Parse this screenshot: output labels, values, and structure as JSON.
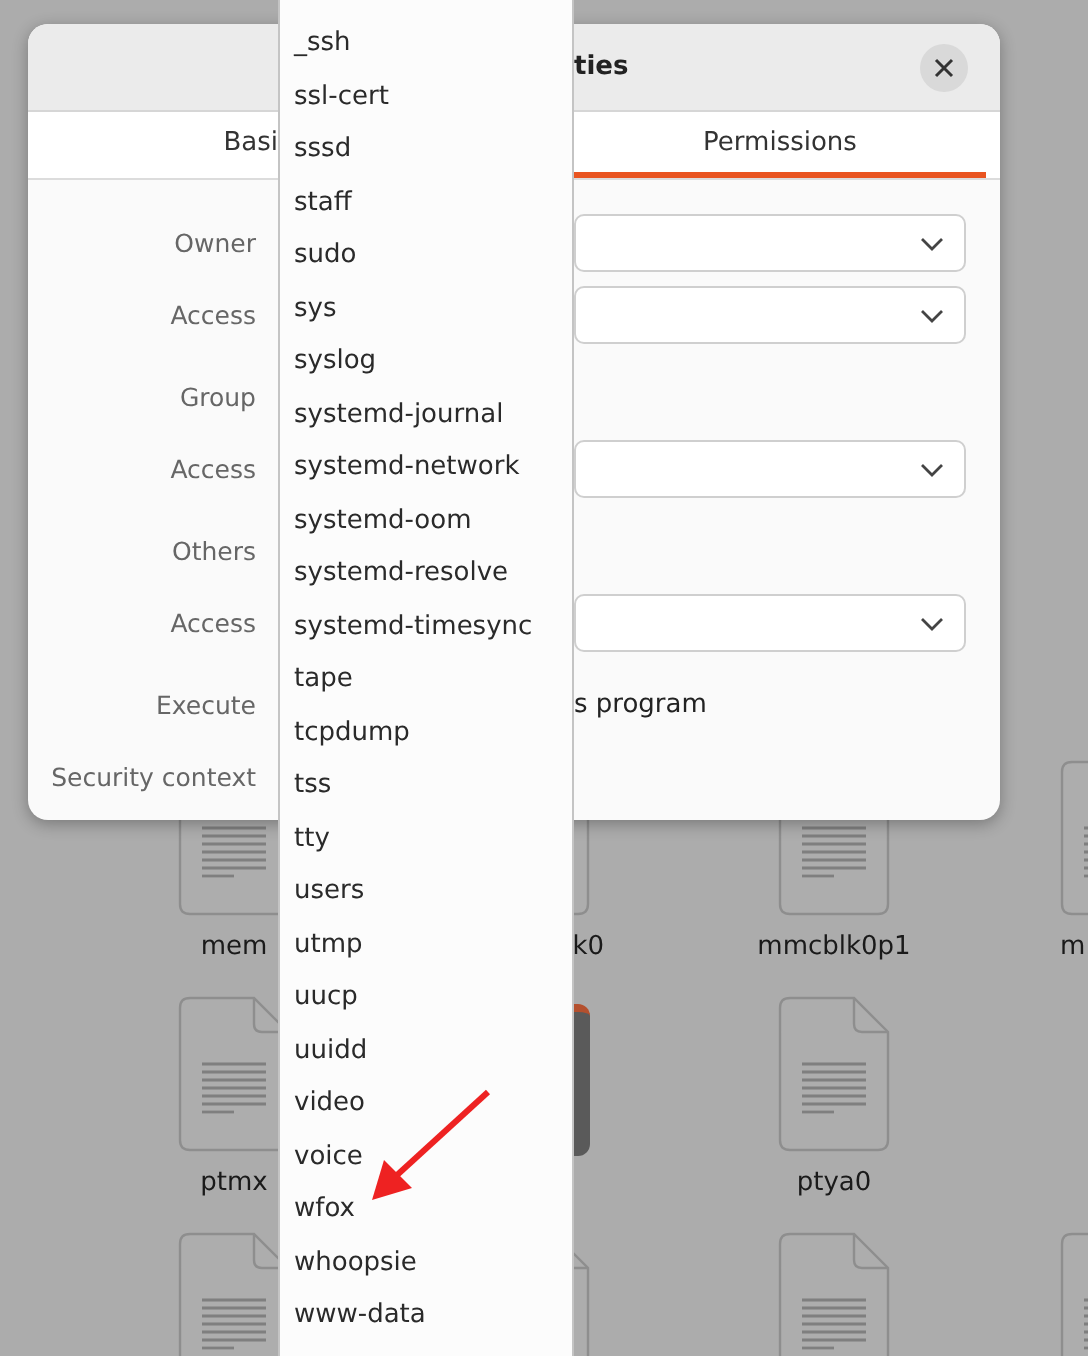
{
  "desktop_rows": [
    [
      {
        "kind": "document",
        "name": "mem"
      },
      {
        "kind": "document",
        "name": "k0"
      },
      {
        "kind": "document",
        "name": "mmcblk0p1"
      },
      {
        "kind": "document",
        "name": "m"
      }
    ],
    [
      {
        "kind": "document",
        "name": "ptmx"
      },
      {
        "kind": "app"
      },
      {
        "kind": "document",
        "name": "ptya0"
      },
      {
        "kind": "empty"
      }
    ],
    [
      {
        "kind": "document"
      },
      {
        "kind": "document"
      },
      {
        "kind": "document"
      },
      {
        "kind": "document"
      }
    ]
  ],
  "dialog": {
    "title": "ties",
    "tabs": [
      {
        "label": "Basi",
        "selected": false
      },
      {
        "label": "Permissions",
        "selected": true
      }
    ],
    "sections": [
      [
        {
          "label": "Owner",
          "kind": "combo"
        },
        {
          "label": "Access",
          "kind": "combo"
        }
      ],
      [
        {
          "label": "Group",
          "kind": "plain"
        },
        {
          "label": "Access",
          "kind": "combo"
        }
      ],
      [
        {
          "label": "Others",
          "kind": "plain"
        },
        {
          "label": "Access",
          "kind": "combo"
        }
      ],
      [
        {
          "label": "Execute",
          "kind": "text",
          "text": "s program"
        },
        {
          "label": "Security context",
          "kind": "plain"
        }
      ]
    ]
  },
  "dropdown": {
    "items": [
      "_ssh",
      "ssl-cert",
      "sssd",
      "staff",
      "sudo",
      "sys",
      "syslog",
      "systemd-journal",
      "systemd-network",
      "systemd-oom",
      "systemd-resolve",
      "systemd-timesync",
      "tape",
      "tcpdump",
      "tss",
      "tty",
      "users",
      "utmp",
      "uucp",
      "uuidd",
      "video",
      "voice",
      "wfox",
      "whoopsie",
      "www-data"
    ]
  }
}
